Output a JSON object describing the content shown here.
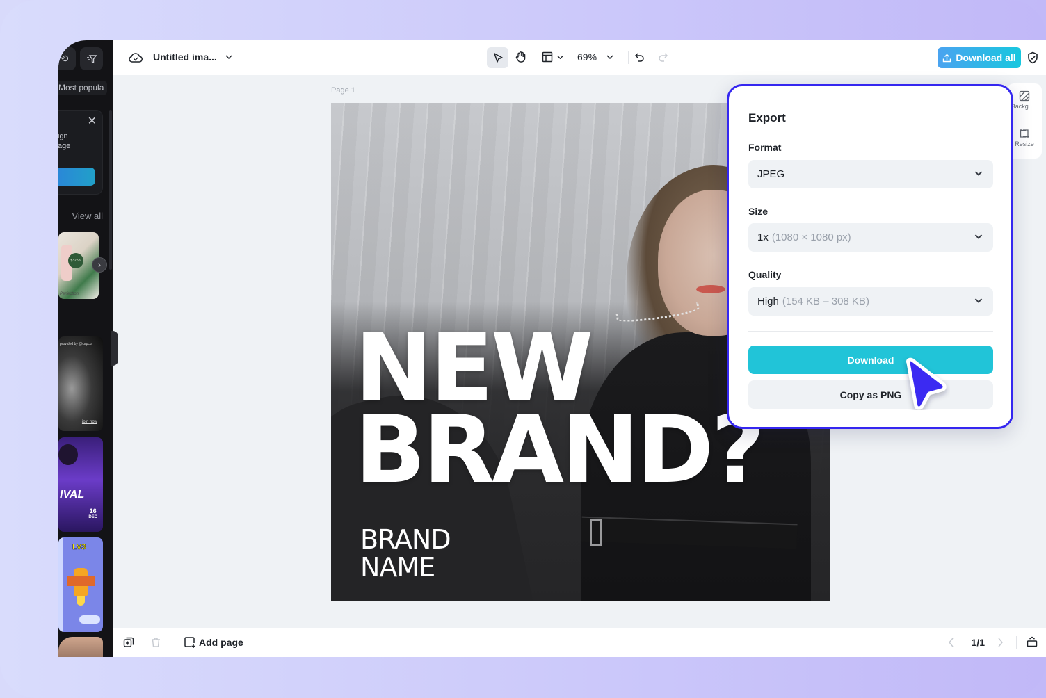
{
  "sidebar": {
    "sort_label": "Most popula",
    "promo_text_line1": "ign",
    "promo_text_line2": "age",
    "view_all": "View all",
    "thumb_price": "$32.99",
    "thumb_caption": "Perfection",
    "thumb2_credit": "provided by @capcut",
    "thumb2_link": "join now",
    "thumb3_title": "IVAL",
    "thumb3_date_day": "16",
    "thumb3_date_month": "DEC",
    "thumb4_badge": "LV3"
  },
  "topbar": {
    "title": "Untitled ima...",
    "zoom": "69%",
    "download_all": "Download all"
  },
  "canvas": {
    "page_label": "Page 1",
    "headline_line1": "NEW",
    "headline_line2": "BRAND?",
    "brand_line1": "BRAND",
    "brand_line2": "NAME"
  },
  "right_panel": {
    "background_label": "Backg...",
    "resize_label": "Resize"
  },
  "export": {
    "title": "Export",
    "format_label": "Format",
    "format_value": "JPEG",
    "size_label": "Size",
    "size_value": "1x",
    "size_detail": "(1080 × 1080 px)",
    "quality_label": "Quality",
    "quality_value": "High",
    "quality_detail": "(154 KB – 308 KB)",
    "download_button": "Download",
    "copy_button": "Copy as PNG"
  },
  "bottombar": {
    "add_page": "Add page",
    "page_indicator": "1/1"
  },
  "colors": {
    "accent_cyan": "#21c4d8",
    "popup_border": "#3527f0",
    "cursor": "#3a2cf2"
  }
}
